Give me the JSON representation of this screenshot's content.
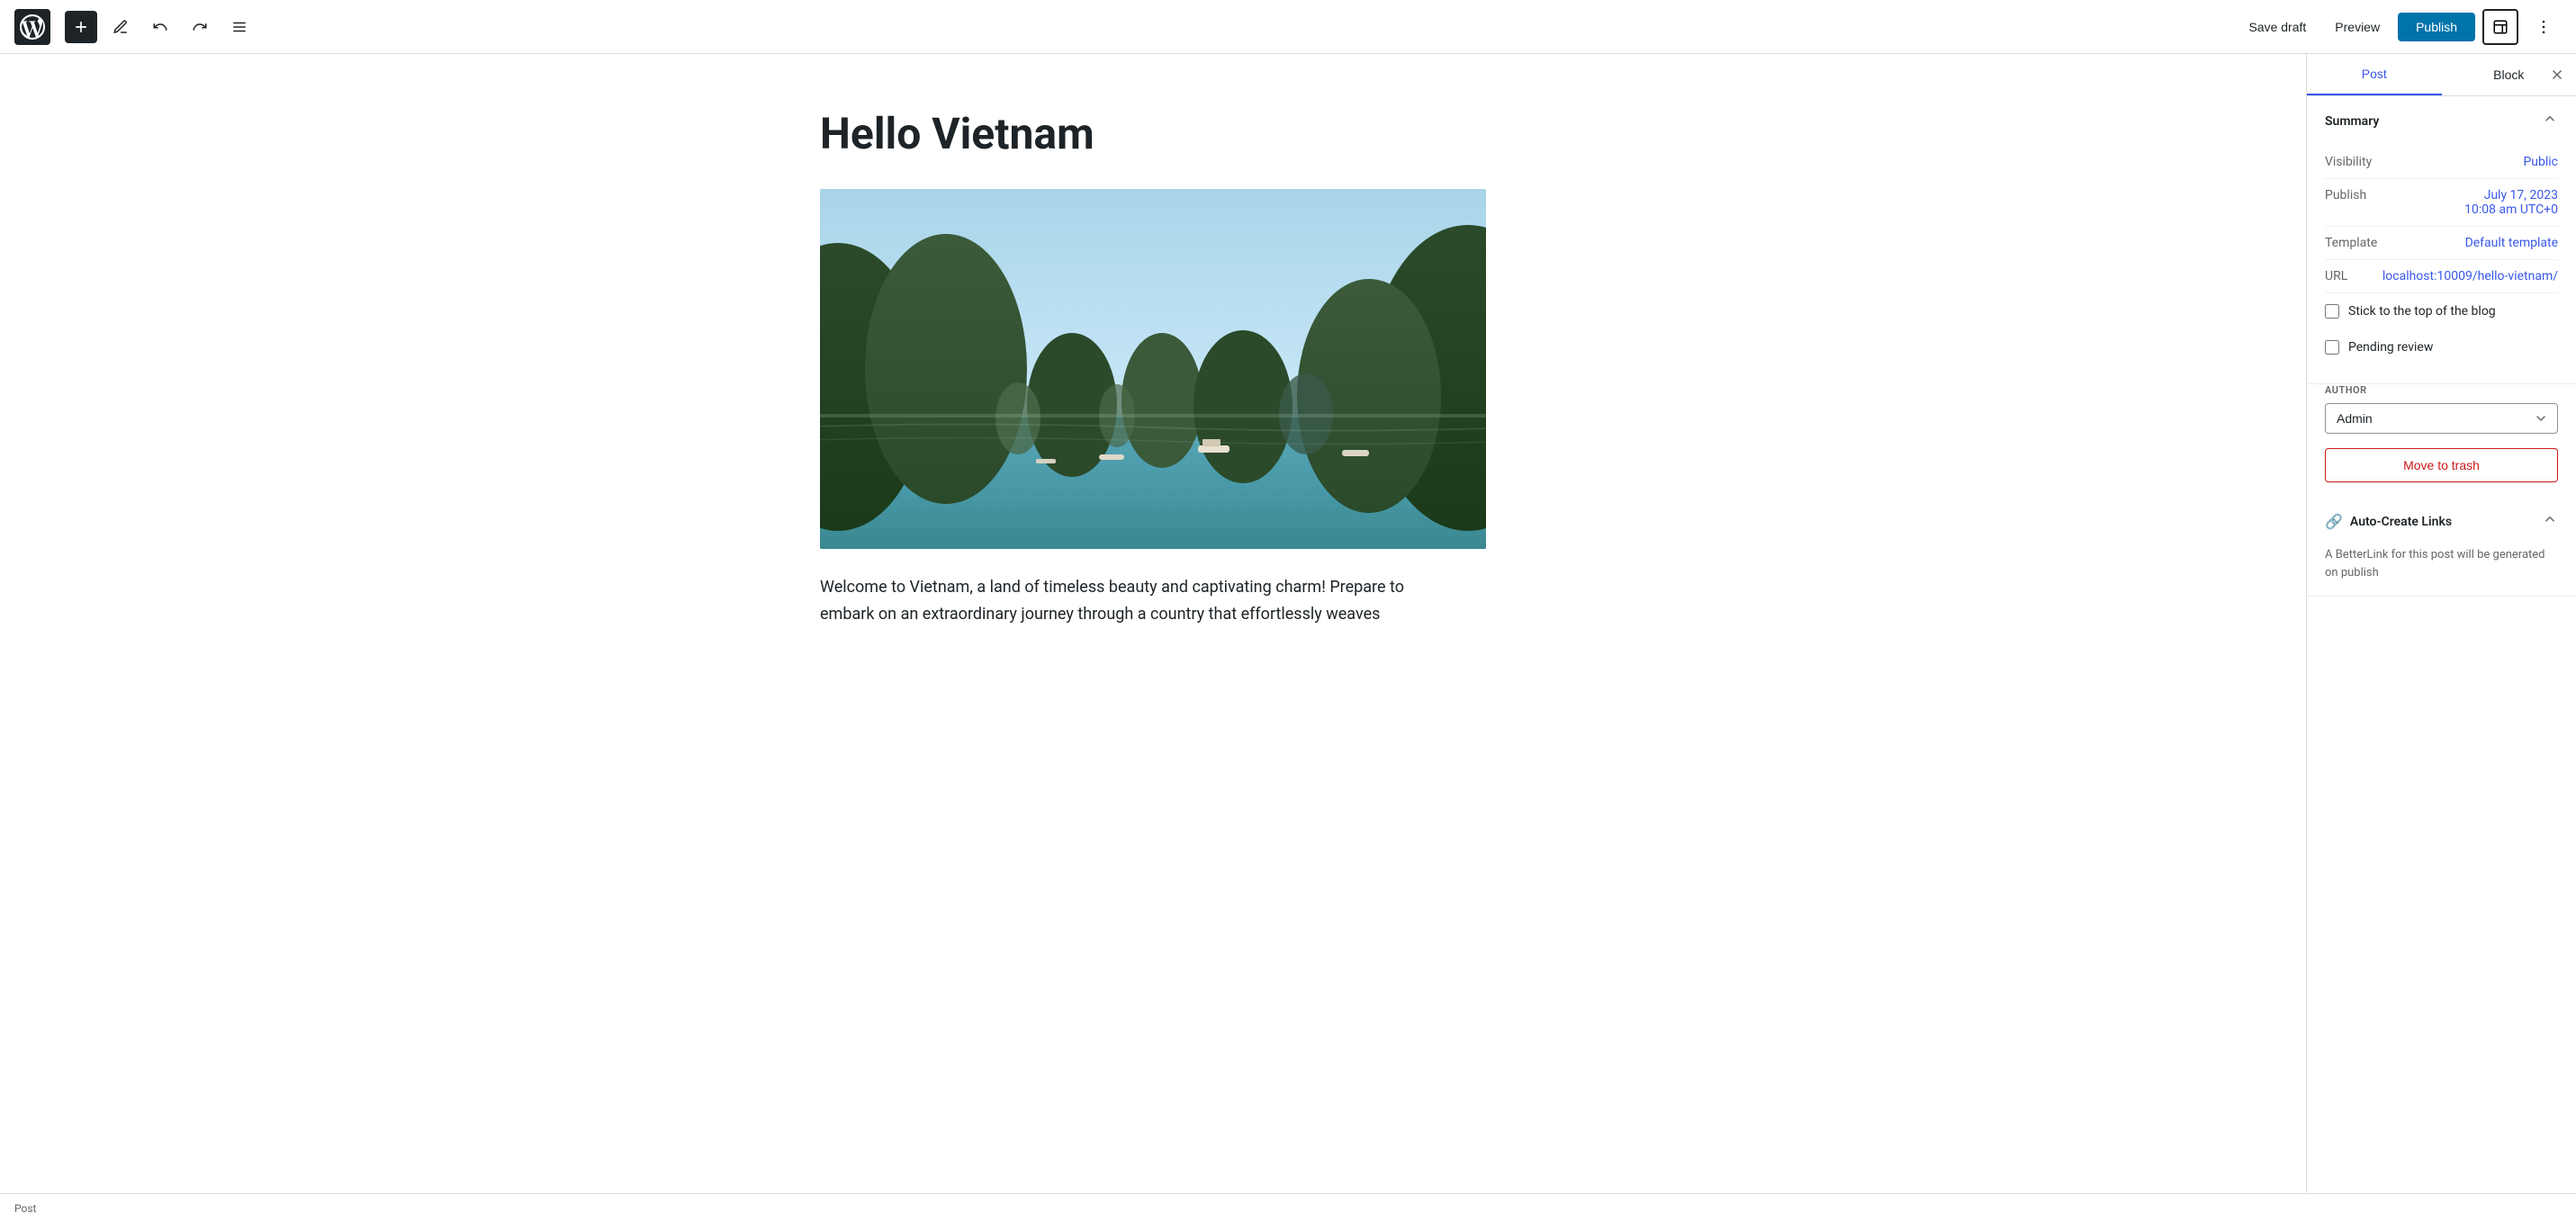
{
  "toolbar": {
    "save_draft_label": "Save draft",
    "preview_label": "Preview",
    "publish_label": "Publish"
  },
  "sidebar": {
    "tab_post": "Post",
    "tab_block": "Block",
    "active_tab": "post",
    "summary_title": "Summary",
    "visibility_label": "Visibility",
    "visibility_value": "Public",
    "publish_label": "Publish",
    "publish_value_line1": "July 17, 2023",
    "publish_value_line2": "10:08 am UTC+0",
    "template_label": "Template",
    "template_value": "Default template",
    "url_label": "URL",
    "url_value": "localhost:10009/hello-vietnam/",
    "stick_to_top_label": "Stick to the top of the blog",
    "pending_review_label": "Pending review",
    "author_label": "AUTHOR",
    "author_value": "Admin",
    "move_to_trash_label": "Move to trash",
    "auto_create_title": "Auto-Create Links",
    "auto_create_body": "A BetterLink for this post will be generated on publish"
  },
  "editor": {
    "post_title": "Hello Vietnam",
    "post_body_line1": "Welcome to Vietnam, a land of timeless beauty and captivating charm! Prepare to",
    "post_body_line2": "embark on an extraordinary journey through a country that effortlessly weaves"
  },
  "status_bar": {
    "label": "Post"
  }
}
